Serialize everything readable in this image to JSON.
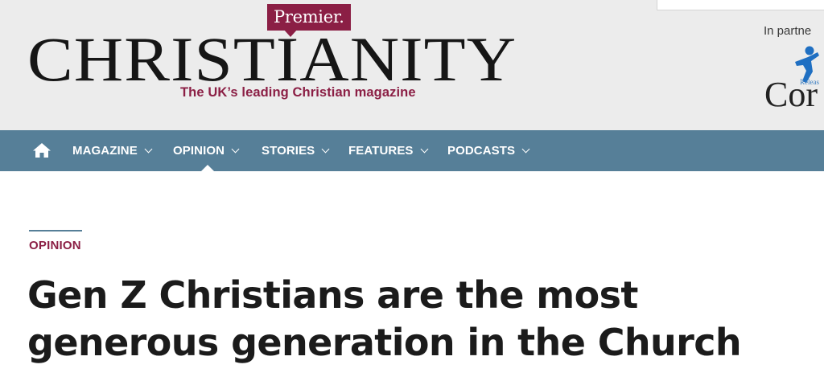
{
  "header": {
    "brand_badge": "Premier.",
    "wordmark": "CHRISTIANITY",
    "tagline": "The UK’s leading Christian magazine",
    "partner_label": "In partne",
    "partner_logo_small": "Releas",
    "partner_logo_name": "Cor",
    "search_placeholder": ""
  },
  "nav": {
    "home_icon": "home-icon",
    "items": [
      {
        "label": "MAGAZINE"
      },
      {
        "label": "OPINION"
      },
      {
        "label": "STORIES"
      },
      {
        "label": "FEATURES"
      },
      {
        "label": "PODCASTS"
      }
    ],
    "active": "OPINION"
  },
  "article": {
    "category": "OPINION",
    "headline": "Gen Z Christians are the most generous generation in the Church"
  },
  "colors": {
    "brand": "#8b1f45",
    "nav_background": "#567f98",
    "header_background": "#ececec",
    "text": "#1b1b1b"
  }
}
